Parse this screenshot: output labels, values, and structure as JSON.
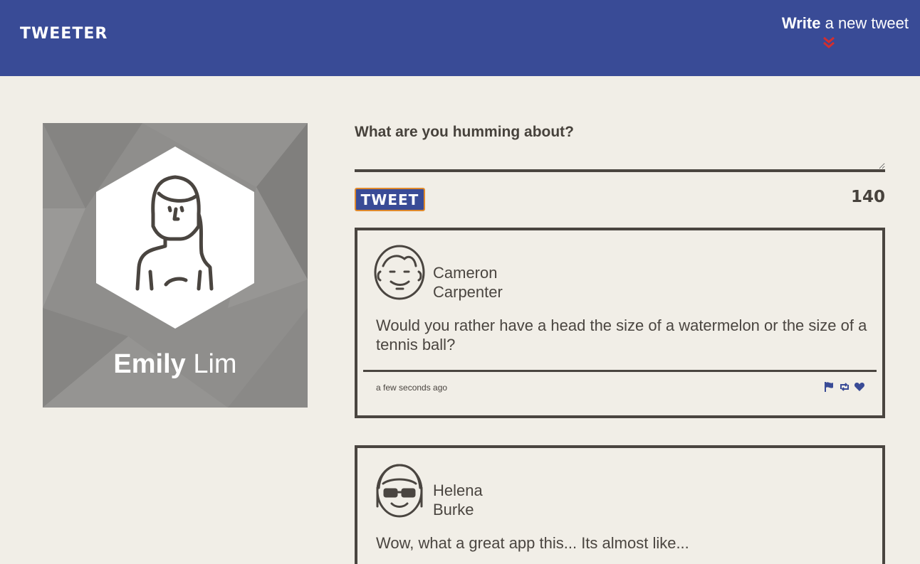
{
  "header": {
    "brand": "TWEETER",
    "compose_bold": "Write",
    "compose_rest": " a new tweet",
    "compose_icon": "double-chevron-down-icon",
    "compose_icon_color": "#d32f2f",
    "bar_color": "#394b96"
  },
  "profile": {
    "first_name": "Emily",
    "last_name": "Lim",
    "avatar_icon": "girl-avatar-icon"
  },
  "composer": {
    "prompt": "What are you humming about?",
    "text": "",
    "tweet_button": "TWEET",
    "counter": "140"
  },
  "tweets": [
    {
      "first_name": "Cameron",
      "last_name": "Carpenter",
      "avatar_icon": "boy-avatar-icon",
      "body": "Would you rather have a head the size of a watermelon or the size of a tennis ball?",
      "time": "a few seconds ago",
      "actions": [
        "flag-icon",
        "retweet-icon",
        "heart-icon"
      ]
    },
    {
      "first_name": "Helena",
      "last_name": "Burke",
      "avatar_icon": "girl-sunglasses-avatar-icon",
      "body": "Wow, what a great app this... Its almost like...",
      "time": "",
      "actions": []
    }
  ]
}
